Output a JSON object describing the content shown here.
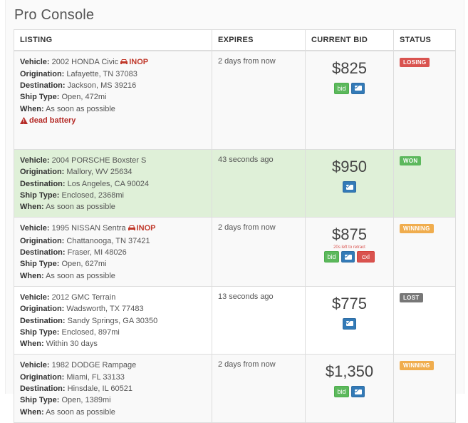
{
  "app": {
    "title": "Pro Console"
  },
  "table": {
    "headers": [
      "LISTING",
      "EXPIRES",
      "CURRENT BID",
      "STATUS"
    ],
    "field_labels": {
      "vehicle": "Vehicle:",
      "origination": "Origination:",
      "destination": "Destination:",
      "ship_type": "Ship Type:",
      "when": "When:"
    },
    "rows": [
      {
        "vehicle": "2002 HONDA Civic",
        "inop": "INOP",
        "origination": "Lafayette, TN 37083",
        "destination": "Jackson, MS 39216",
        "ship_type": "Open, 472mi",
        "when": "As soon as possible",
        "warning": "dead battery",
        "expires": "2 days from now",
        "bid": "$825",
        "retract_note": "",
        "bid_label": "bid",
        "cxl_label": "",
        "status": "LOSING",
        "status_color": "#d9534f"
      },
      {
        "vehicle": "2004 PORSCHE Boxster S",
        "inop": "",
        "origination": "Mallory, WV 25634",
        "destination": "Los Angeles, CA 90024",
        "ship_type": "Enclosed, 2368mi",
        "when": "As soon as possible",
        "warning": "",
        "expires": "43 seconds ago",
        "bid": "$950",
        "retract_note": "",
        "bid_label": "",
        "cxl_label": "",
        "status": "WON",
        "status_color": "#5cb85c"
      },
      {
        "vehicle": "1995 NISSAN Sentra",
        "inop": "INOP",
        "origination": "Chattanooga, TN 37421",
        "destination": "Fraser, MI 48026",
        "ship_type": "Open, 627mi",
        "when": "As soon as possible",
        "warning": "",
        "expires": "2 days from now",
        "bid": "$875",
        "retract_note": "20s left to retract",
        "bid_label": "bid",
        "cxl_label": "cxl",
        "status": "WINNING",
        "status_color": "#f0ad4e"
      },
      {
        "vehicle": "2012 GMC Terrain",
        "inop": "",
        "origination": "Wadsworth, TX 77483",
        "destination": "Sandy Springs, GA 30350",
        "ship_type": "Enclosed, 897mi",
        "when": "Within 30 days",
        "warning": "",
        "expires": "13 seconds ago",
        "bid": "$775",
        "retract_note": "",
        "bid_label": "",
        "cxl_label": "",
        "status": "LOST",
        "status_color": "#777777"
      },
      {
        "vehicle": "1982 DODGE Rampage",
        "inop": "",
        "origination": "Miami, FL 33133",
        "destination": "Hinsdale, IL 60521",
        "ship_type": "Open, 1389mi",
        "when": "As soon as possible",
        "warning": "",
        "expires": "2 days from now",
        "bid": "$1,350",
        "retract_note": "",
        "bid_label": "bid",
        "cxl_label": "",
        "status": "WINNING",
        "status_color": "#f0ad4e"
      }
    ]
  },
  "icons": {
    "inop": "car-icon",
    "warning": "warning-triangle-icon",
    "message": "envelope-icon"
  }
}
